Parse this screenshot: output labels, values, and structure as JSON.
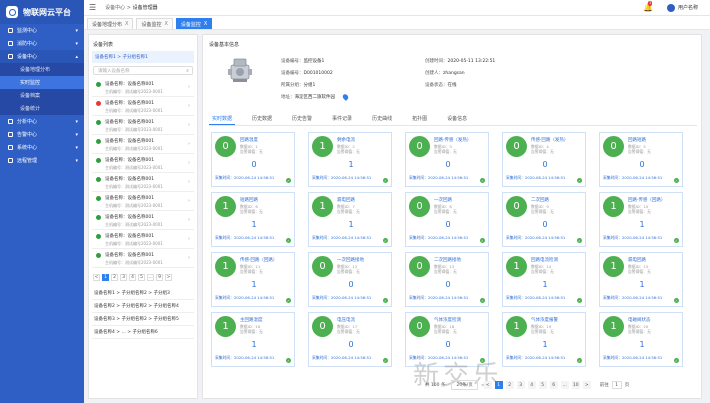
{
  "brand": {
    "title": "物联网云平台"
  },
  "sidebar": {
    "items": [
      {
        "label": "监测中心",
        "expanded": false
      },
      {
        "label": "消防中心",
        "expanded": false
      },
      {
        "label": "设备中心",
        "expanded": true,
        "children": [
          {
            "label": "设备地理分布",
            "active": false
          },
          {
            "label": "实时监控",
            "active": true
          },
          {
            "label": "设备档案",
            "active": false
          },
          {
            "label": "设备统计",
            "active": false
          }
        ]
      },
      {
        "label": "分析中心",
        "expanded": false
      },
      {
        "label": "告警中心",
        "expanded": false
      },
      {
        "label": "系统中心",
        "expanded": false
      },
      {
        "label": "远程管理",
        "expanded": false
      }
    ]
  },
  "header": {
    "crumb_parent": "设备中心",
    "crumb_sep": ">",
    "crumb_current": "设备管理器",
    "bell_count": "1",
    "user_name": "用户名称"
  },
  "tabs": [
    {
      "label": "设备地理分布",
      "active": false,
      "close": "X"
    },
    {
      "label": "设备监控",
      "active": false,
      "close": "X"
    },
    {
      "label": "设备监控",
      "active": true,
      "close": "X"
    }
  ],
  "device_panel": {
    "title": "设备列表",
    "selected_path": "设备名称1 > 子分组名称1",
    "search_placeholder": "请输入设备名称",
    "items": [
      {
        "name": "设备名称：设备名称001",
        "sub": "主机编号：测试编号2023-0001",
        "status": "green"
      },
      {
        "name": "设备名称：设备名称001",
        "sub": "主机编号：测试编号2023-0001",
        "status": "red"
      },
      {
        "name": "设备名称：设备名称001",
        "sub": "主机编号：测试编号2023-0001",
        "status": "green"
      },
      {
        "name": "设备名称：设备名称001",
        "sub": "主机编号：测试编号2023-0001",
        "status": "green"
      },
      {
        "name": "设备名称：设备名称001",
        "sub": "主机编号：测试编号2023-0001",
        "status": "green"
      },
      {
        "name": "设备名称：设备名称001",
        "sub": "主机编号：测试编号2023-0001",
        "status": "green"
      },
      {
        "name": "设备名称：设备名称001",
        "sub": "主机编号：测试编号2023-0001",
        "status": "green"
      },
      {
        "name": "设备名称：设备名称001",
        "sub": "主机编号：测试编号2023-0001",
        "status": "green"
      },
      {
        "name": "设备名称：设备名称001",
        "sub": "主机编号：测试编号2023-0001",
        "status": "green"
      },
      {
        "name": "设备名称：设备名称001",
        "sub": "主机编号：测试编号2023-0001",
        "status": "green"
      }
    ],
    "pager": {
      "prev": "<",
      "pages": [
        "1",
        "2",
        "3",
        "4",
        "5",
        "...",
        "9"
      ],
      "next": ">",
      "active": "1"
    },
    "groups": [
      "设备名称1 > 子分组名称2 > 子分组3",
      "设备名称2 > 子分组名称2 > 子分组名称4",
      "设备名称3 > 子分组名称2 > 子分组名称5",
      "设备名称4 > ... > 子分组名称6"
    ]
  },
  "main": {
    "title": "设备基本信息",
    "info": {
      "code_label": "设备编号：",
      "code": "监控设备1",
      "serial_label": "设备编号：",
      "serial": "D001010002",
      "group_label": "所属分组：",
      "group": "分组1",
      "address_label": "地址：",
      "address": "海淀区西二旗软件园",
      "created_label": "创建时间：",
      "created": "2020-05-11 13:22:51",
      "creator_label": "创建人：",
      "creator": "zhangsan",
      "state_label": "设备状态：",
      "state": "在线"
    },
    "subtabs": [
      {
        "label": "实时数据",
        "active": true
      },
      {
        "label": "历史数据",
        "active": false
      },
      {
        "label": "历史告警",
        "active": false
      },
      {
        "label": "事件记录",
        "active": false
      },
      {
        "label": "历史曲线",
        "active": false
      },
      {
        "label": "拓扑图",
        "active": false
      },
      {
        "label": "设备信息",
        "active": false
      }
    ],
    "cards": [
      {
        "name": "回路温度",
        "meta1": "数据ID：1",
        "meta2": "告警阈值：无",
        "value": "0",
        "time_label": "采集时间：",
        "time": "2020-06-24 14:56:51"
      },
      {
        "name": "剩余电流",
        "meta1": "数据ID：2",
        "meta2": "告警阈值：无",
        "value": "1",
        "time_label": "采集时间：",
        "time": "2020-06-24 14:56:51"
      },
      {
        "name": "回路·传感（发热）",
        "meta1": "数据ID：3",
        "meta2": "告警阈值：无",
        "value": "0",
        "time_label": "采集时间：",
        "time": "2020-06-24 14:56:51"
      },
      {
        "name": "传感·回路（发热）",
        "meta1": "数据ID：4",
        "meta2": "告警阈值：无",
        "value": "0",
        "time_label": "采集时间：",
        "time": "2020-06-24 14:56:51"
      },
      {
        "name": "回路短路",
        "meta1": "数据ID：5",
        "meta2": "告警阈值：无",
        "value": "0",
        "time_label": "采集时间：",
        "time": "2020-06-24 14:56:51"
      },
      {
        "name": "短路回路",
        "meta1": "数据ID：6",
        "meta2": "告警阈值：无",
        "value": "1",
        "time_label": "采集时间：",
        "time": "2020-06-24 14:56:51"
      },
      {
        "name": "漏电回路",
        "meta1": "数据ID：7",
        "meta2": "告警阈值：无",
        "value": "1",
        "time_label": "采集时间：",
        "time": "2020-06-24 14:56:51"
      },
      {
        "name": "一次回路",
        "meta1": "数据ID：8",
        "meta2": "告警阈值：无",
        "value": "0",
        "time_label": "采集时间：",
        "time": "2020-06-24 14:56:51"
      },
      {
        "name": "二次回路",
        "meta1": "数据ID：9",
        "meta2": "告警阈值：无",
        "value": "0",
        "time_label": "采集时间：",
        "time": "2020-06-24 14:56:51"
      },
      {
        "name": "回路·传感（回路）",
        "meta1": "数据ID：10",
        "meta2": "告警阈值：无",
        "value": "1",
        "time_label": "采集时间：",
        "time": "2020-06-24 14:56:51"
      },
      {
        "name": "传感·回路（回路）",
        "meta1": "数据ID：11",
        "meta2": "告警阈值：无",
        "value": "1",
        "time_label": "采集时间：",
        "time": "2020-06-24 14:56:51"
      },
      {
        "name": "一次回路接地",
        "meta1": "数据ID：12",
        "meta2": "告警阈值：无",
        "value": "0",
        "time_label": "采集时间：",
        "time": "2020-06-24 14:56:51"
      },
      {
        "name": "二次回路接地",
        "meta1": "数据ID：13",
        "meta2": "告警阈值：无",
        "value": "0",
        "time_label": "采集时间：",
        "time": "2020-06-24 14:56:51"
      },
      {
        "name": "回路电流检测",
        "meta1": "数据ID：14",
        "meta2": "告警阈值：无",
        "value": "1",
        "time_label": "采集时间：",
        "time": "2020-06-24 14:56:51"
      },
      {
        "name": "漏电回路",
        "meta1": "数据ID：15",
        "meta2": "告警阈值：无",
        "value": "1",
        "time_label": "采集时间：",
        "time": "2020-06-24 14:56:51"
      },
      {
        "name": "主回路温度",
        "meta1": "数据ID：16",
        "meta2": "告警阈值：无",
        "value": "1",
        "time_label": "采集时间：",
        "time": "2020-06-24 14:56:51"
      },
      {
        "name": "电压电流",
        "meta1": "数据ID：17",
        "meta2": "告警阈值：无",
        "value": "0",
        "time_label": "采集时间：",
        "time": "2020-06-24 14:56:51"
      },
      {
        "name": "气体浓度检测",
        "meta1": "数据ID：18",
        "meta2": "告警阈值：无",
        "value": "0",
        "time_label": "采集时间：",
        "time": "2020-06-24 14:56:51"
      },
      {
        "name": "气体浓度报警",
        "meta1": "数据ID：19",
        "meta2": "告警阈值：无",
        "value": "1",
        "time_label": "采集时间：",
        "time": "2020-06-24 14:56:51"
      },
      {
        "name": "电磁阀状态",
        "meta1": "数据ID：20",
        "meta2": "告警阈值：无",
        "value": "1",
        "time_label": "采集时间：",
        "time": "2020-06-24 14:56:51"
      }
    ],
    "watermark": "新交乐",
    "pager": {
      "total": "共 100 条",
      "size": "20条/页",
      "prev": "<",
      "pages": [
        "1",
        "2",
        "3",
        "4",
        "5",
        "6",
        "...",
        "10"
      ],
      "next": ">",
      "active": "1",
      "goto_label": "前往",
      "goto_value": "1",
      "goto_suffix": "页"
    }
  },
  "colors": {
    "sidebar": "#2f5fc4",
    "accent": "#2f80ed",
    "ok": "#4caf50",
    "alarm": "#e53935"
  }
}
